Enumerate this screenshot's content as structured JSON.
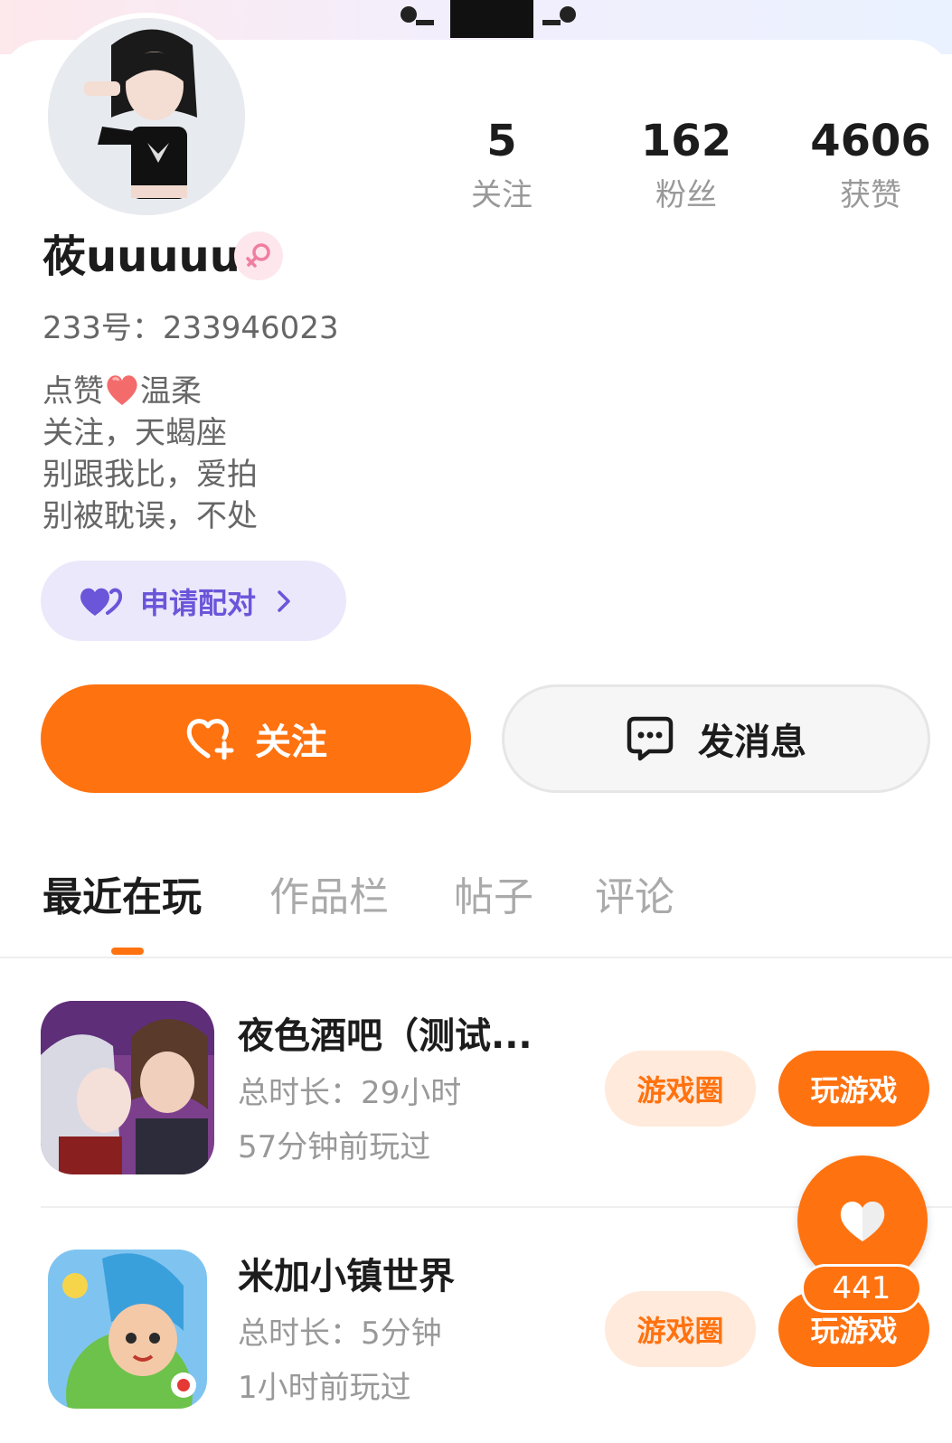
{
  "profile": {
    "username": "莜uuuuu",
    "uid_text": "233号：233946023",
    "bio_lines": [
      "点赞",
      "温柔",
      "关注，天蝎座",
      "别跟我比，爱拍",
      "别被耽误，不处"
    ],
    "stats": [
      {
        "value": "5",
        "label": "关注"
      },
      {
        "value": "162",
        "label": "粉丝"
      },
      {
        "value": "4606",
        "label": "获赞"
      }
    ],
    "pair_button": "申请配对",
    "follow_button": "关注",
    "message_button": "发消息"
  },
  "tabs": [
    "最近在玩",
    "作品栏",
    "帖子",
    "评论"
  ],
  "active_tab": "最近在玩",
  "games": [
    {
      "title": "夜色酒吧（测试...",
      "duration": "总时长：29小时",
      "last_played": "57分钟前玩过",
      "circle_label": "游戏圈",
      "play_label": "玩游戏"
    },
    {
      "title": "米加小镇世界",
      "duration": "总时长：5分钟",
      "last_played": "1小时前玩过",
      "circle_label": "游戏圈",
      "play_label": "玩游戏"
    }
  ],
  "floating_like": {
    "count": "441"
  },
  "colors": {
    "accent": "#ff7210",
    "pair_purple": "#6b55d9",
    "gender_pink": "#f07ea0"
  }
}
